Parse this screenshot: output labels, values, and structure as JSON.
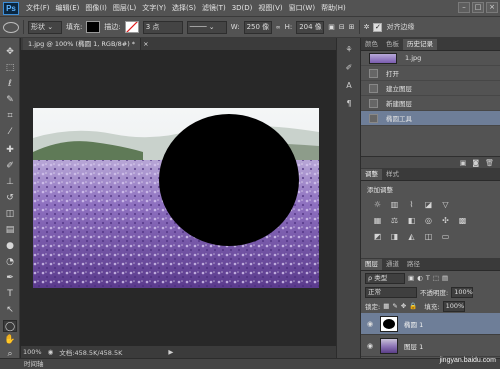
{
  "app": {
    "logo": "Ps"
  },
  "menu": [
    "文件(F)",
    "编辑(E)",
    "图像(I)",
    "图层(L)",
    "文字(Y)",
    "选择(S)",
    "滤镜(T)",
    "3D(D)",
    "视图(V)",
    "窗口(W)",
    "帮助(H)"
  ],
  "window_controls": [
    "–",
    "□",
    "×"
  ],
  "options_bar": {
    "mode": "形状",
    "fill_label": "填充:",
    "stroke_label": "描边:",
    "stroke_size": "3 点",
    "w_label": "W:",
    "w_value": "250 像",
    "h_label": "H:",
    "h_value": "204 像",
    "align_edges": "对齐边缘",
    "fill_color": "#000000"
  },
  "document": {
    "tab_title": "1.jpg @ 100% (椭圆 1, RGB/8#) *",
    "close": "×"
  },
  "status": {
    "zoom": "100%",
    "doc_size": "文档:458.5K/458.5K"
  },
  "bottom_panel_tab": "时间轴",
  "history_panel": {
    "tabs": [
      "颜色",
      "色板",
      "历史记录"
    ],
    "snapshot": "1.jpg",
    "steps": [
      "打开",
      "建立图层",
      "新建图层",
      "椭圆工具"
    ],
    "selected_index": 3
  },
  "adjustments_panel": {
    "tabs": [
      "调整",
      "样式"
    ],
    "title": "添加调整"
  },
  "layers_panel": {
    "tabs": [
      "图层",
      "通道",
      "路径"
    ],
    "filter": "ρ 类型",
    "blend_mode": "正常",
    "opacity_label": "不透明度:",
    "opacity_value": "100%",
    "lock_label": "锁定:",
    "fill_label": "填充:",
    "fill_value": "100%",
    "layers": [
      {
        "name": "椭圆 1",
        "selected": true
      },
      {
        "name": "图层 1",
        "selected": false
      }
    ]
  },
  "watermark": "jingyan.baidu.com"
}
